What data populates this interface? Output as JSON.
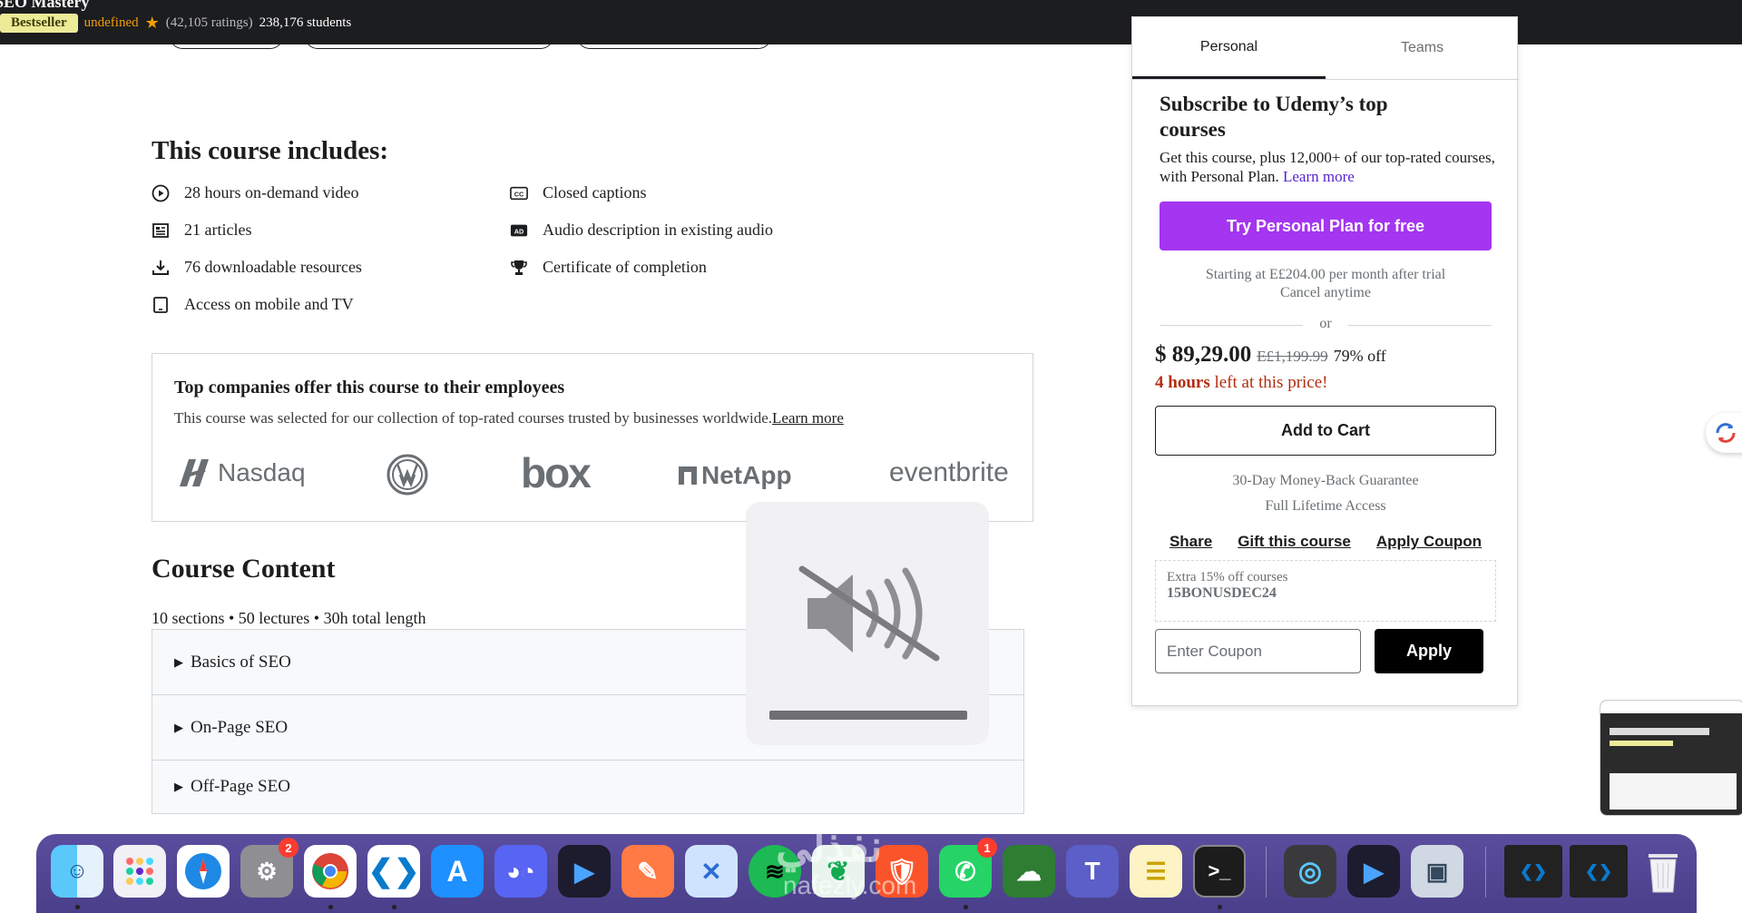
{
  "header": {
    "course_title": "SEO Mastery",
    "badge": "Bestseller",
    "rating_value": "undefined",
    "ratings_count": "(42,105 ratings)",
    "students": "238,176 students"
  },
  "includes": {
    "title": "This course includes:",
    "items": [
      {
        "icon": "play-circle-icon",
        "label": "28 hours on-demand video"
      },
      {
        "icon": "article-icon",
        "label": "21 articles"
      },
      {
        "icon": "download-icon",
        "label": "76 downloadable resources"
      },
      {
        "icon": "mobile-icon",
        "label": "Access on mobile and TV"
      },
      {
        "icon": "closed-captions-icon",
        "label": "Closed captions"
      },
      {
        "icon": "audio-description-icon",
        "label": "Audio description in existing audio"
      },
      {
        "icon": "trophy-icon",
        "label": "Certificate of completion"
      }
    ]
  },
  "companies": {
    "title": "Top companies offer this course to their employees",
    "description": "This course was selected for our collection of top-rated courses trusted by businesses worldwide.",
    "learn_more": "Learn more",
    "logos": [
      "Nasdaq",
      "VW",
      "box",
      "NetApp",
      "eventbrite"
    ]
  },
  "course_content": {
    "title": "Course Content",
    "meta": "10 sections • 50 lectures • 30h total length",
    "sections": [
      "Basics of SEO",
      "On-Page SEO",
      "Off-Page SEO"
    ]
  },
  "purchase": {
    "tabs": [
      "Personal",
      "Teams"
    ],
    "active_tab": "Personal",
    "heading": "Subscribe to Udemy’s top courses",
    "subtext": "Get this course, plus 12,000+ of our top-rated courses, with Personal Plan.",
    "learn_more": "Learn more",
    "try_button": "Try Personal Plan for free",
    "trial_note_1": "Starting at E£204.00 per month after trial",
    "trial_note_2": "Cancel anytime",
    "or": "or",
    "price": "$ 89,29.00",
    "original_price": "E£1,199.99",
    "discount": "79% off",
    "timer_bold": "4 hours",
    "timer_rest": " left at this price!",
    "add_to_cart": "Add to Cart",
    "guarantee": "30-Day Money-Back Guarantee",
    "access": "Full Lifetime Access",
    "links": [
      "Share",
      "Gift this course",
      "Apply Coupon"
    ],
    "coupon_note": "Extra 15% off courses",
    "coupon_code": "15BONUSDEC24",
    "coupon_placeholder": "Enter Coupon",
    "apply_button": "Apply"
  },
  "dock": {
    "watermark_arabic": "نفذلي",
    "watermark_latin": "nafezly.com",
    "badges": {
      "settings": "2",
      "whatsapp": "1"
    },
    "apps": [
      "Finder",
      "Launchpad",
      "Safari",
      "System Settings",
      "Chrome",
      "VS Code",
      "App Store",
      "Discord",
      "Video Player",
      "Pages",
      "Xcode Helper",
      "Spotify",
      "MongoDB",
      "Brave",
      "WhatsApp",
      "CleanShot",
      "Teams",
      "Notes",
      "Terminal",
      "QuickTime",
      "Video Player 2",
      "Preview",
      "Window 1",
      "Window 2",
      "Trash"
    ]
  },
  "colors": {
    "header_bg": "#1c1d1f",
    "badge_bg": "#eceb98",
    "rating_orange": "#f69c08",
    "primary_purple": "#a435f0",
    "link_purple": "#5624d0",
    "timer_red": "#b32d0f",
    "dock_bg": "#4a3f8a"
  }
}
